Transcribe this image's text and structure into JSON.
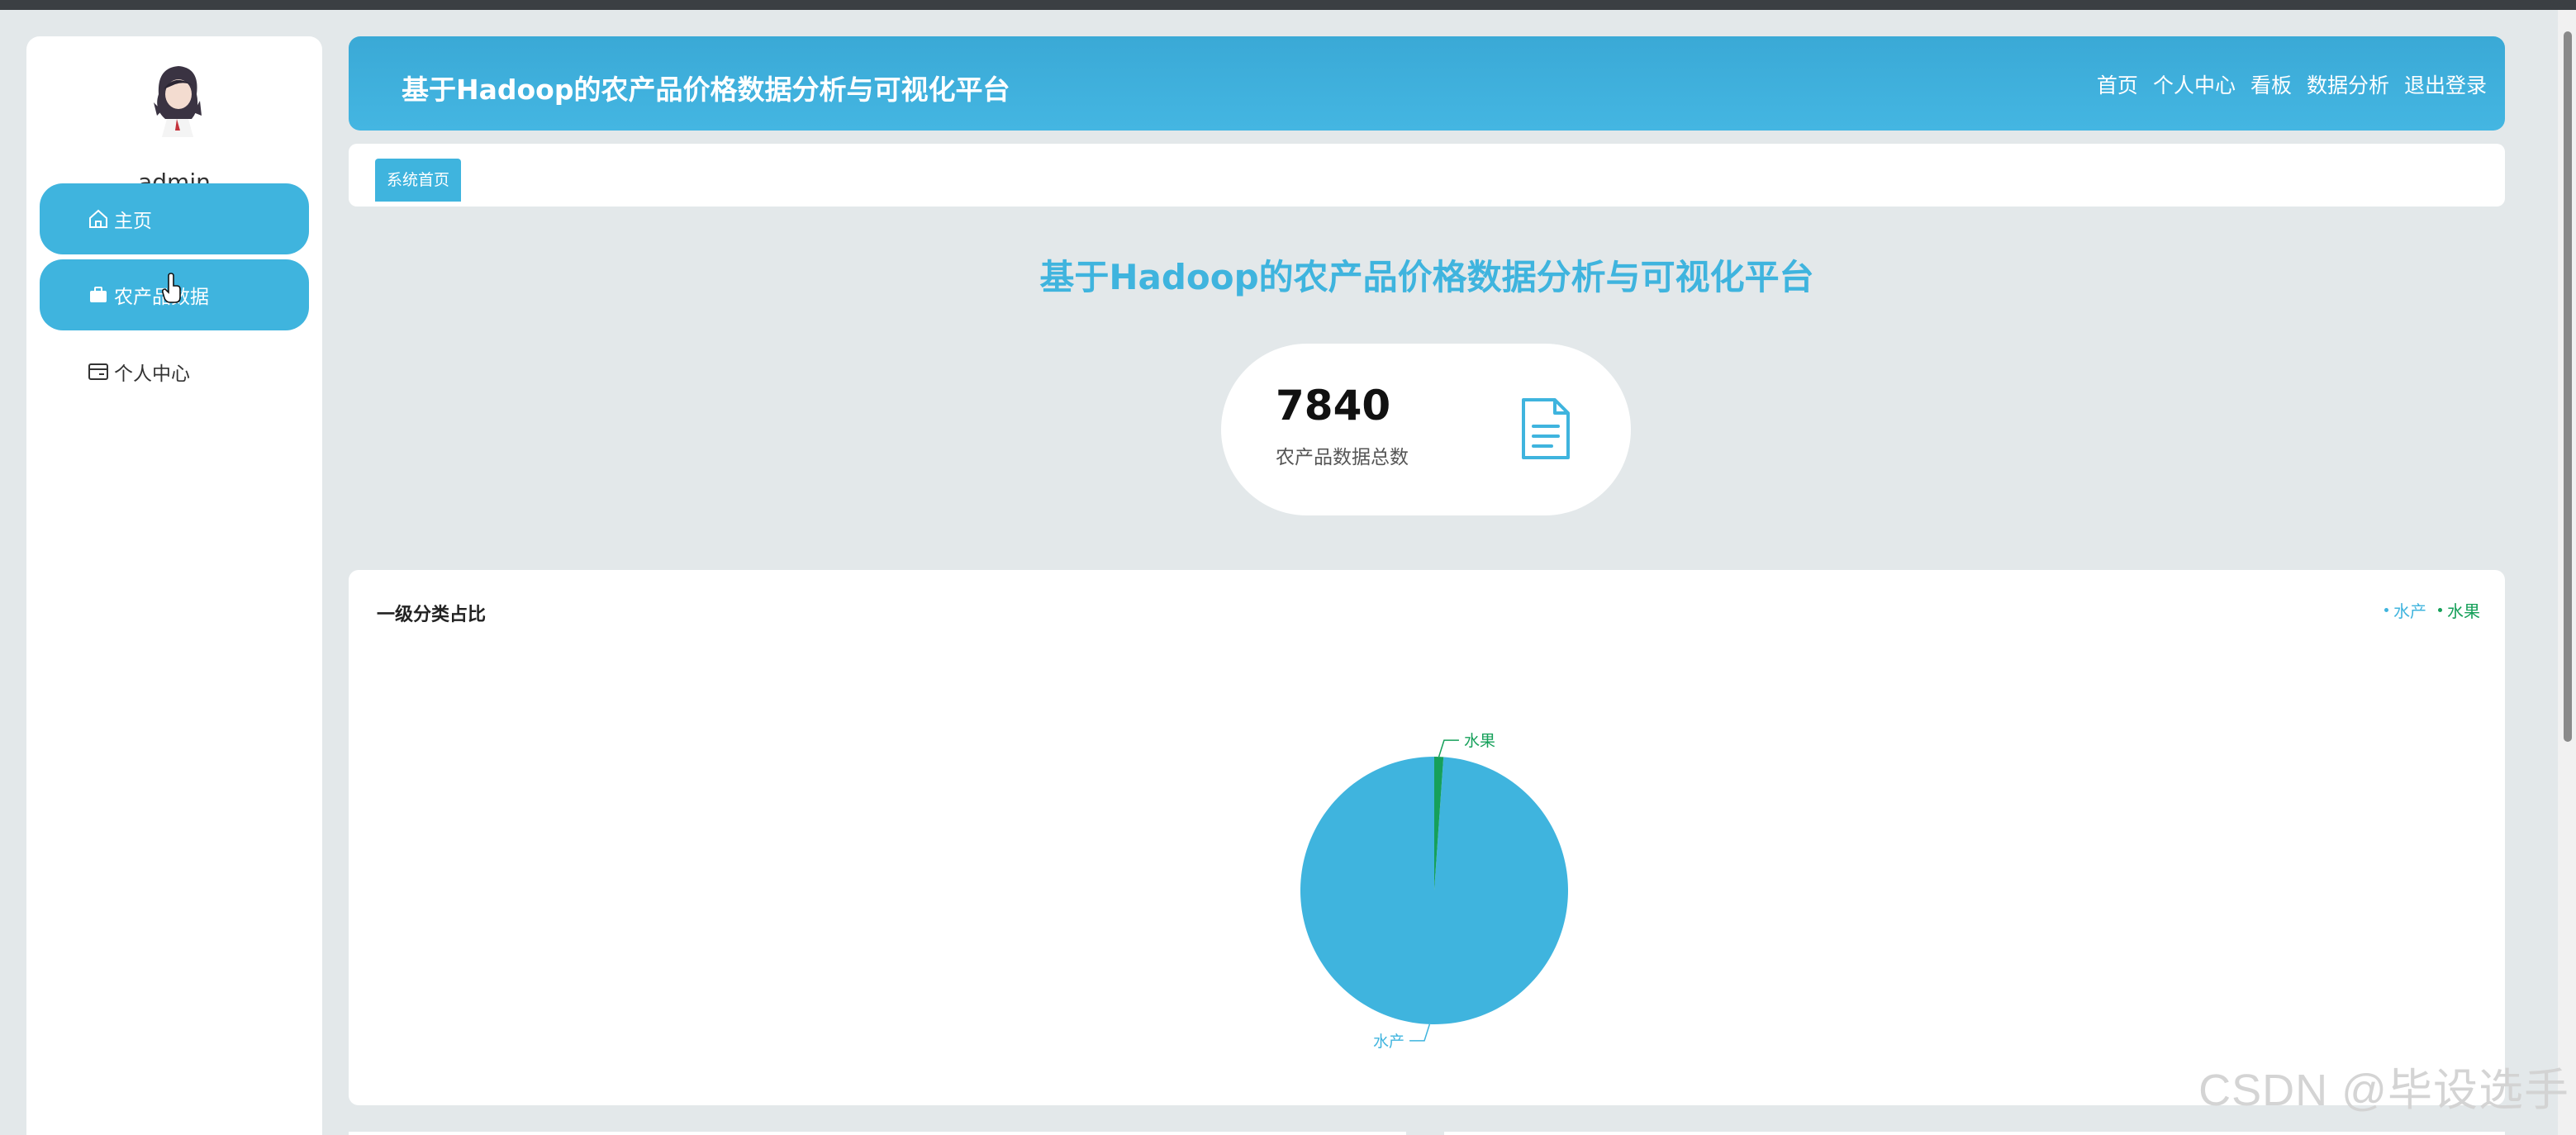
{
  "user": {
    "name": "admin"
  },
  "sidebar": {
    "items": [
      {
        "label": "主页",
        "icon": "home-icon",
        "active": true
      },
      {
        "label": "农产品数据",
        "icon": "briefcase-icon",
        "active": true
      },
      {
        "label": "个人中心",
        "icon": "card-icon",
        "active": false
      }
    ]
  },
  "header": {
    "title": "基于Hadoop的农产品价格数据分析与可视化平台",
    "nav": [
      "首页",
      "个人中心",
      "看板",
      "数据分析",
      "退出登录"
    ]
  },
  "breadcrumb": {
    "tab": "系统首页"
  },
  "main": {
    "title": "基于Hadoop的农产品价格数据分析与可视化平台",
    "stat": {
      "value": "7840",
      "label": "农产品数据总数",
      "icon": "document-icon"
    }
  },
  "chart_data": {
    "type": "pie",
    "title": "一级分类占比",
    "categories": [
      "水产",
      "水果"
    ],
    "values": [
      98.9,
      1.1
    ],
    "colors": [
      "#3fb4de",
      "#16a05a"
    ],
    "legend_position": "top-right"
  },
  "colors": {
    "accent": "#3fb4de",
    "fruit": "#16a05a",
    "background": "#e3e8ea"
  },
  "watermark": "CSDN @毕设选手"
}
